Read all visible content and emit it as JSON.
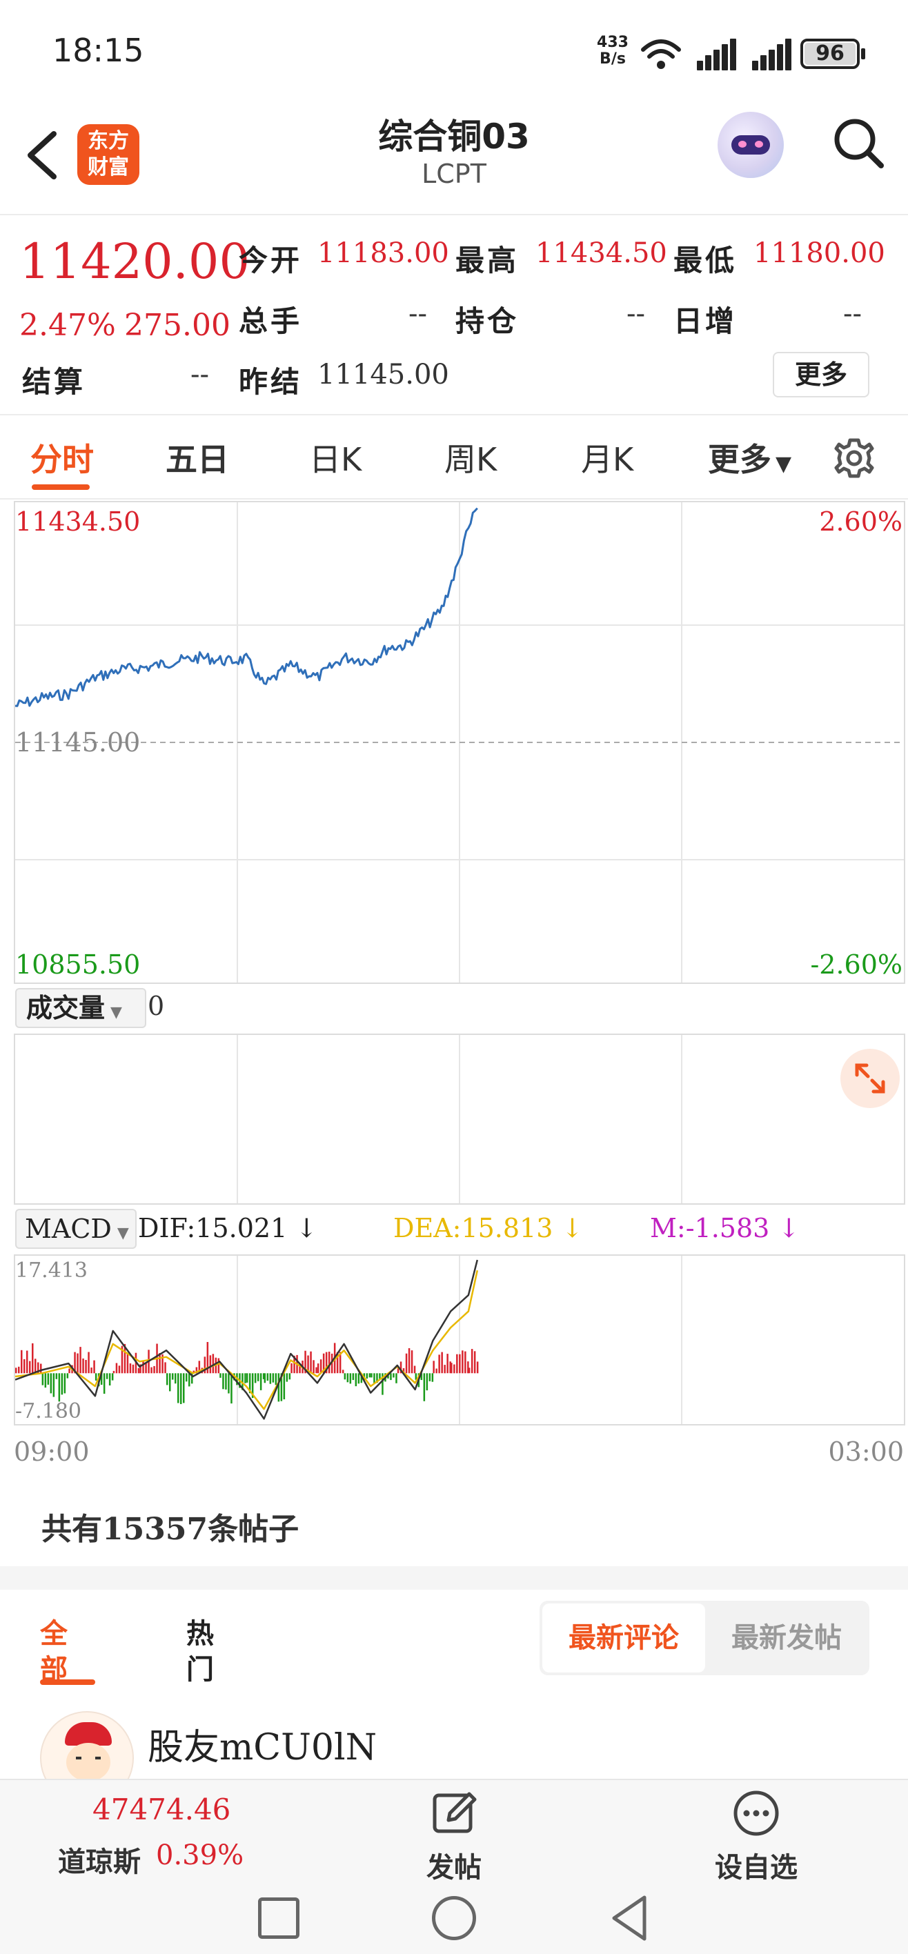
{
  "status_bar": {
    "time": "18:15",
    "net_speed_top": "433",
    "net_speed_unit": "B/s",
    "battery": "96"
  },
  "header": {
    "title": "综合铜03",
    "subtitle": "LCPT",
    "logo_text_line1": "东方",
    "logo_text_line2": "财富"
  },
  "quote": {
    "price": "11420.00",
    "change_pct": "2.47%",
    "change_abs": "275.00",
    "open_label": "今开",
    "open": "11183.00",
    "high_label": "最高",
    "high": "11434.50",
    "low_label": "最低",
    "low": "11180.00",
    "volume_label": "总手",
    "volume": "--",
    "position_label": "持仓",
    "position": "--",
    "daily_add_label": "日增",
    "daily_add": "--",
    "settle_label": "结算",
    "settle": "--",
    "prev_settle_label": "昨结",
    "prev_settle": "11145.00",
    "more_button": "更多"
  },
  "tabs": [
    {
      "label": "分时",
      "active": true
    },
    {
      "label": "五日"
    },
    {
      "label": "日K"
    },
    {
      "label": "周K"
    },
    {
      "label": "月K"
    },
    {
      "label": "更多"
    }
  ],
  "chart_data": [
    {
      "type": "line",
      "y_top_label": "11434.50",
      "y_mid_label": "11145.00",
      "y_bottom_label": "10855.50",
      "pct_top_label": "2.60%",
      "pct_bottom_label": "-2.60%",
      "ylim": [
        10855.5,
        11434.5
      ],
      "reference_line": 11145.0,
      "x_start_label": "09:00",
      "x_end_label": "03:00",
      "series": [
        {
          "color": "#2f6fb9",
          "x_fraction_of_session": [
            0.0,
            0.03,
            0.06,
            0.09,
            0.12,
            0.15,
            0.18,
            0.21,
            0.24,
            0.26,
            0.28,
            0.31,
            0.34,
            0.37,
            0.4,
            0.42,
            0.44,
            0.46,
            0.48,
            0.5,
            0.505,
            0.51,
            0.515,
            0.52
          ],
          "values": [
            11190,
            11200,
            11205,
            11225,
            11235,
            11238,
            11245,
            11250,
            11245,
            11248,
            11215,
            11240,
            11225,
            11250,
            11245,
            11262,
            11265,
            11285,
            11310,
            11370,
            11395,
            11405,
            11425,
            11434
          ]
        }
      ]
    },
    {
      "type": "bar",
      "name": "成交量",
      "value_label": "0"
    },
    {
      "type": "line",
      "indicator": "MACD",
      "dif_label": "DIF:15.021 ↓",
      "dea_label": "DEA:15.813 ↓",
      "m_label": "M:-1.583 ↓",
      "y_top_label": "17.413",
      "y_bottom_label": "-7.180",
      "ylim": [
        -7.18,
        17.413
      ],
      "dif_color": "#333333",
      "dea_color": "#e8b800",
      "m_color": "#c020c0",
      "x_fraction_of_session": [
        0.0,
        0.03,
        0.06,
        0.09,
        0.11,
        0.14,
        0.17,
        0.2,
        0.23,
        0.26,
        0.28,
        0.31,
        0.34,
        0.37,
        0.4,
        0.43,
        0.45,
        0.47,
        0.49,
        0.51,
        0.52
      ],
      "dif": [
        -1.0,
        0.5,
        1.5,
        -3.5,
        6.5,
        1.0,
        3.5,
        -0.5,
        1.8,
        -3.0,
        -7.0,
        3.0,
        -1.5,
        4.5,
        -3.0,
        1.2,
        -2.5,
        5.0,
        9.5,
        12.0,
        17.4
      ],
      "dea": [
        -0.5,
        0.0,
        1.0,
        -2.0,
        4.5,
        1.8,
        2.5,
        0.0,
        1.5,
        -2.0,
        -5.5,
        2.0,
        -0.5,
        3.5,
        -2.0,
        1.0,
        -1.5,
        3.5,
        7.0,
        9.5,
        15.8
      ],
      "histogram_signs": [
        1,
        -1,
        1,
        -1,
        1,
        1,
        -1,
        1,
        -1,
        -1,
        -1,
        1,
        1,
        -1,
        -1,
        1,
        -1,
        1,
        1,
        1,
        -1
      ]
    }
  ],
  "volume_dropdown": "成交量",
  "macd_dropdown": "MACD",
  "posts": {
    "count_text": "共有15357条帖子",
    "tab_all": "全部",
    "tab_hot": "热门",
    "sort_latest_comment": "最新评论",
    "sort_latest_post": "最新发帖",
    "first_user": "股友mCU0lN"
  },
  "bottom_bar": {
    "index_value": "47474.46",
    "index_name": "道琼斯",
    "index_pct": "0.39%",
    "post_button": "发帖",
    "watchlist_button": "设自选"
  },
  "colors": {
    "accent": "#f0541e",
    "up": "#d9232d",
    "down": "#1a9a1a",
    "line": "#2f6fb9"
  }
}
